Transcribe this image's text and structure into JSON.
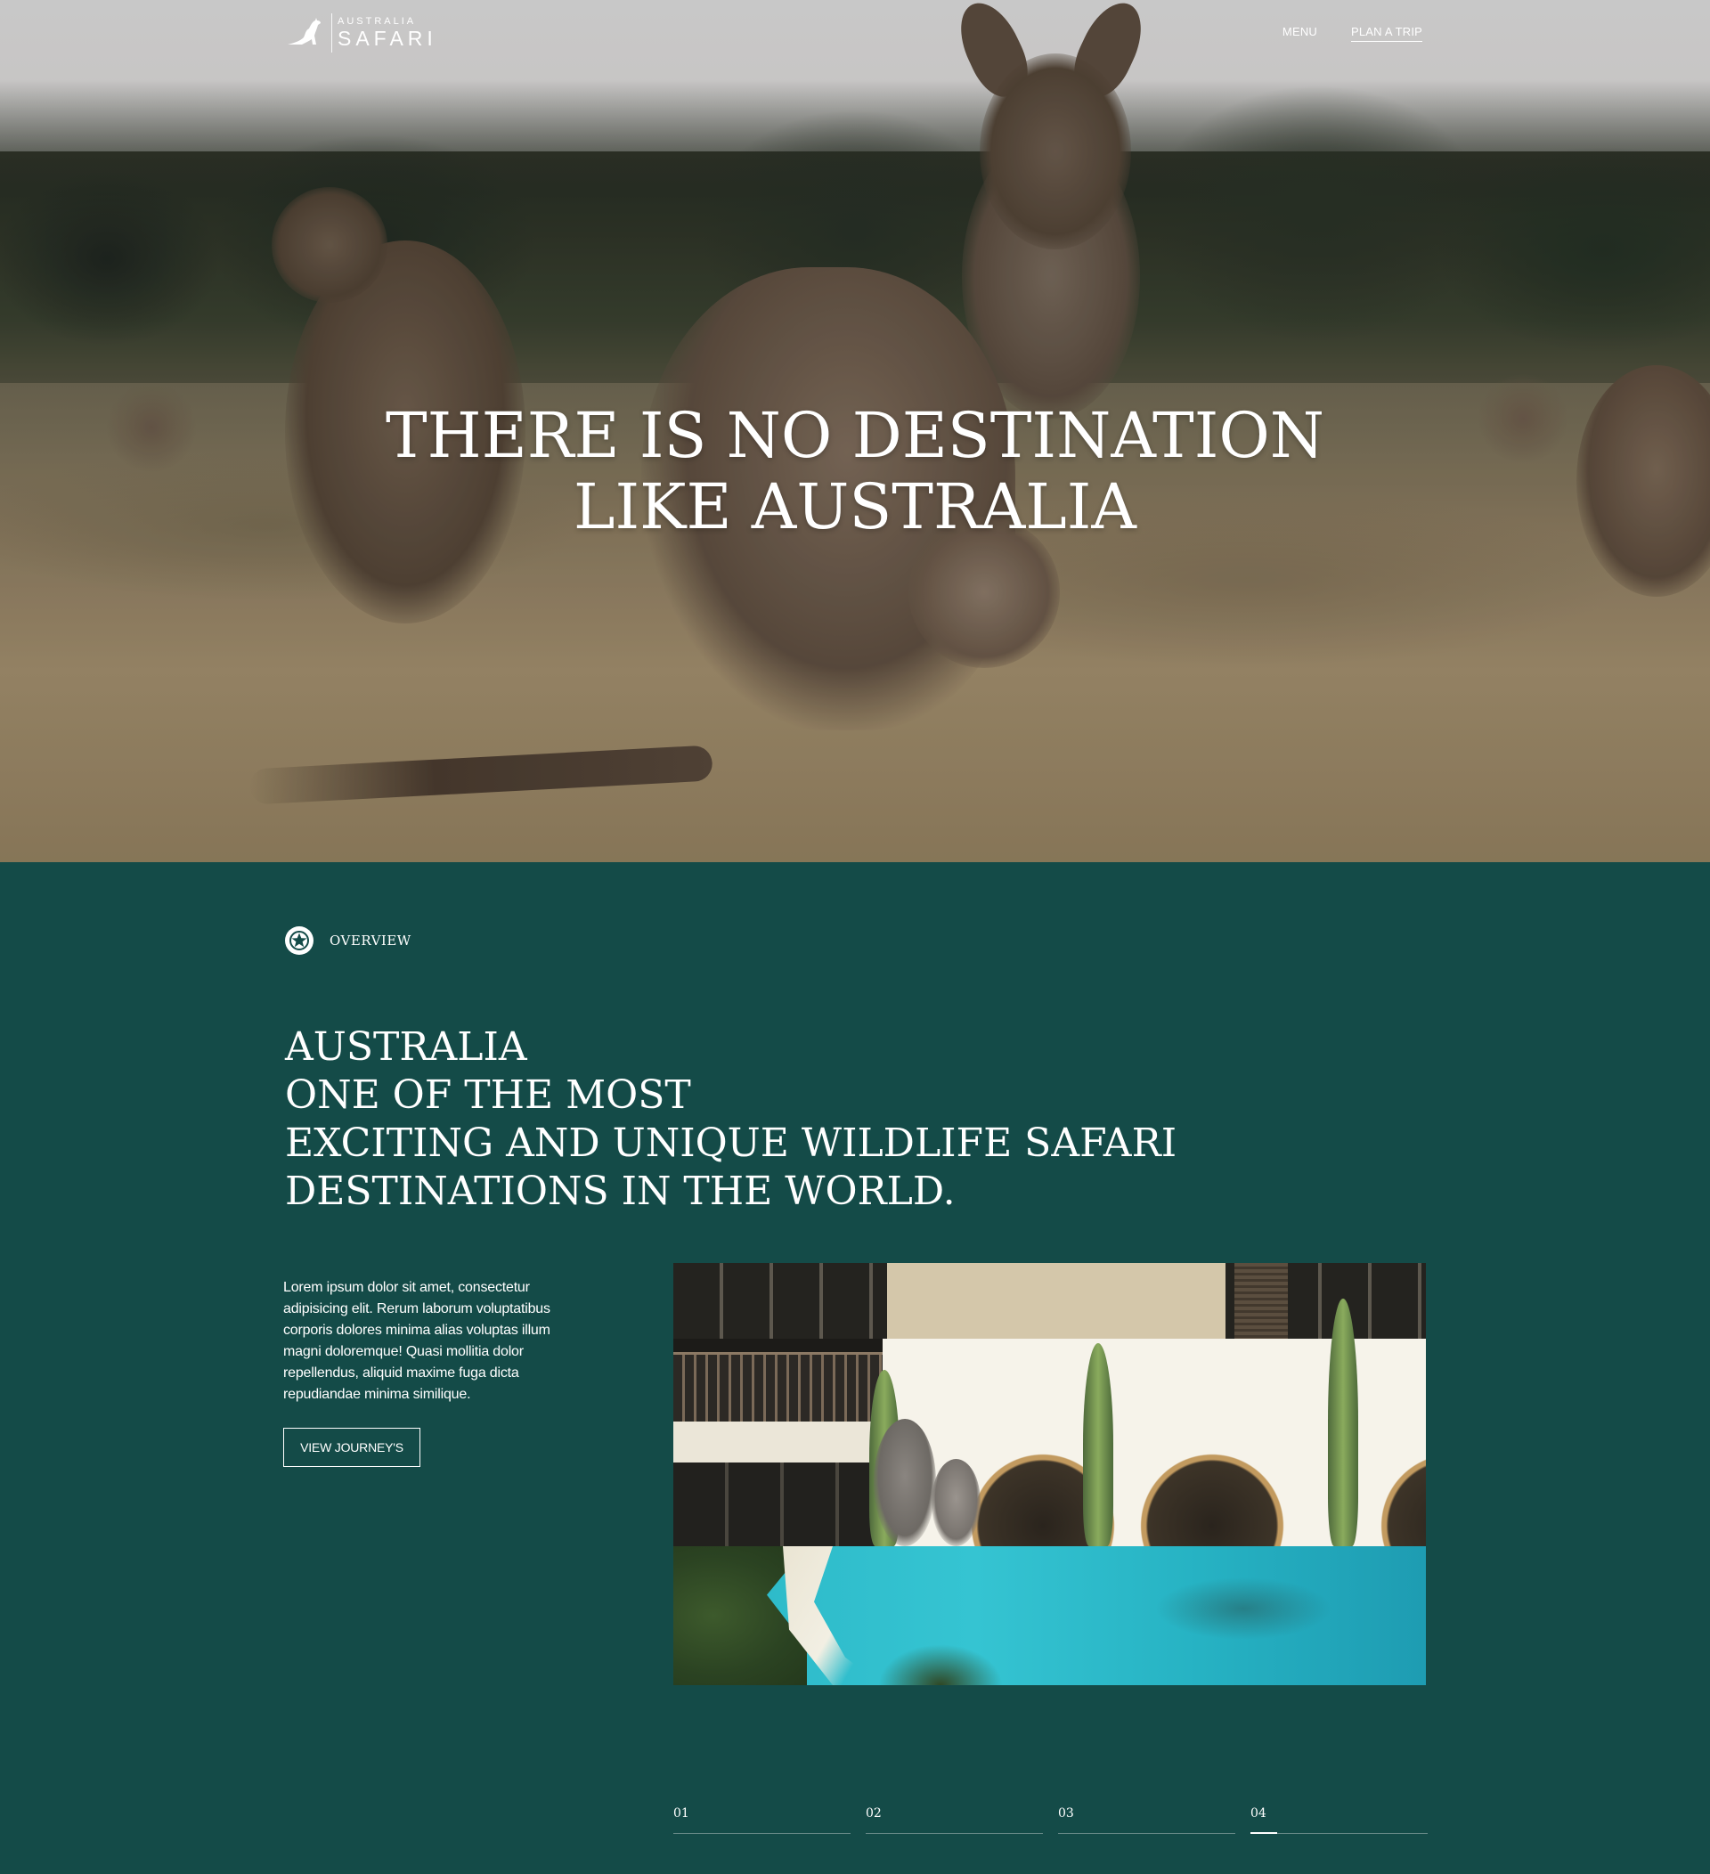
{
  "colors": {
    "section_bg": "#144b48",
    "text": "#ffffff"
  },
  "header": {
    "logo_top": "AUSTRALIA",
    "logo_bottom": "SAFARI",
    "logo_icon": "kangaroo-icon",
    "nav": {
      "menu_label": "MENU",
      "plan_label": "PLAN A TRIP"
    }
  },
  "hero": {
    "title_line1": "THERE IS NO DESTINATION",
    "title_line2": "LIKE AUSTRALIA"
  },
  "overview": {
    "icon": "compass-star-icon",
    "label": "OVERVIEW",
    "heading_lines": [
      "AUSTRALIA",
      "ONE OF THE MOST",
      "EXCITING AND UNIQUE WILDLIFE SAFARI",
      "DESTINATIONS IN THE WORLD."
    ],
    "intro": "Lorem ipsum dolor sit amet, consectetur adipisicing elit. Rerum laborum voluptatibus corporis dolores minima alias voluptas illum magni doloremque! Quasi mollitia dolor repellendus, aliquid maxime fuga dicta repudiandae minima similique.",
    "button_label": "VIEW JOURNEY'S"
  },
  "tabs": [
    {
      "label": "01",
      "active": false
    },
    {
      "label": "02",
      "active": false
    },
    {
      "label": "03",
      "active": false
    },
    {
      "label": "04",
      "active": true
    }
  ]
}
